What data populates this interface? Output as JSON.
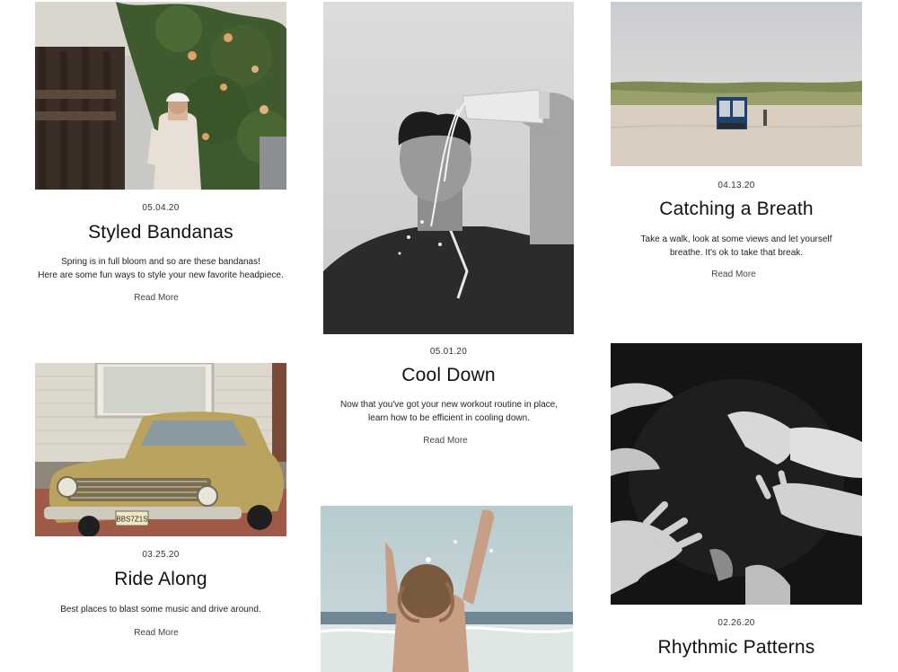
{
  "posts": [
    {
      "date": "05.04.20",
      "title": "Styled Bandanas",
      "excerpt_line1": "Spring is in full bloom and so are these bandanas!",
      "excerpt_line2": "Here are some fun ways to style your new favorite headpiece.",
      "read_more": "Read More",
      "image": "woman-in-bandana-photo"
    },
    {
      "date": "05.01.20",
      "title": "Cool Down",
      "excerpt_line1": "Now that you've got your new workout routine in place,",
      "excerpt_line2": "learn how to be efficient in cooling down.",
      "read_more": "Read More",
      "image": "man-pouring-water-photo"
    },
    {
      "date": "04.13.20",
      "title": "Catching a Breath",
      "excerpt_line1": "Take a walk, look at some views and let yourself",
      "excerpt_line2": "breathe. It's ok to take that break.",
      "read_more": "Read More",
      "image": "beach-dunes-photo"
    },
    {
      "date": "03.25.20",
      "title": "Ride Along",
      "excerpt_line1": "Best places to blast some music and drive around.",
      "read_more": "Read More",
      "image": "vintage-car-photo",
      "license_plate": "BBS7Z1S"
    },
    {
      "image": "woman-splashing-sea-photo"
    },
    {
      "date": "02.26.20",
      "title": "Rhythmic Patterns",
      "image": "hands-reaching-photo"
    }
  ]
}
